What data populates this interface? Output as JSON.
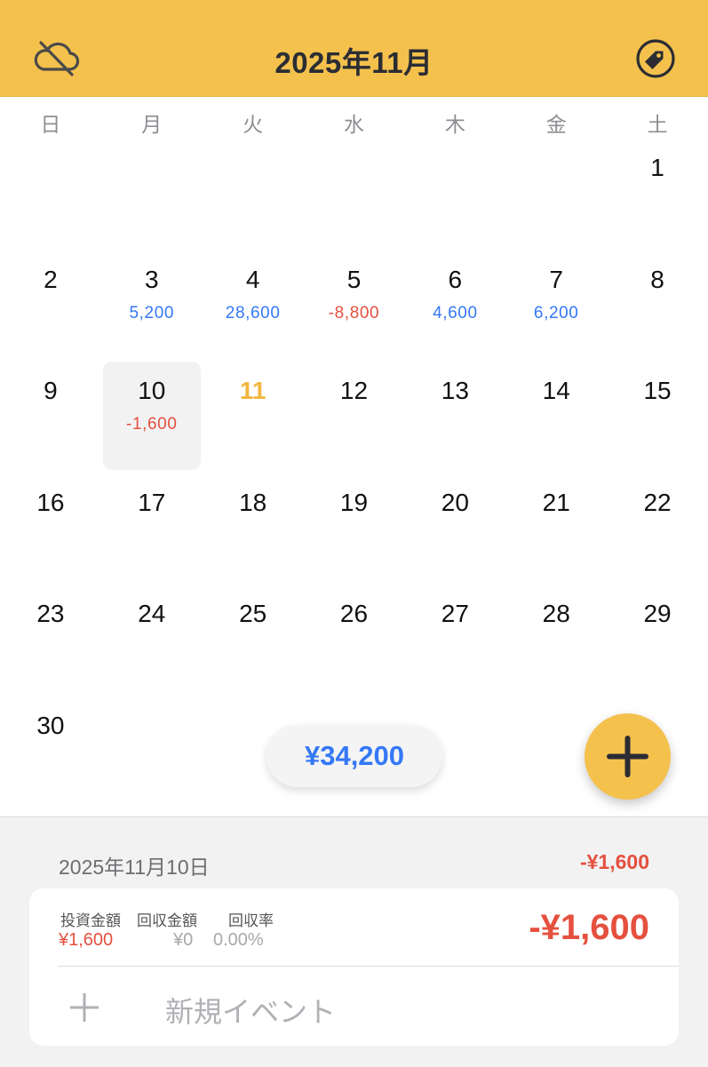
{
  "header": {
    "title": "2025年11月",
    "left_icon": "cloud-off-icon",
    "right_icon": "tag-icon",
    "color": "#f4c14d"
  },
  "weekdays": [
    "日",
    "月",
    "火",
    "水",
    "木",
    "金",
    "土"
  ],
  "month": {
    "first_weekday_index": 6,
    "days_in_month": 30,
    "today": 11,
    "selected": 10,
    "amounts": {
      "3": "5,200",
      "4": "28,600",
      "5": "-8,800",
      "6": "4,600",
      "7": "6,200",
      "10": "-1,600"
    }
  },
  "total_pill": "¥34,200",
  "fab_icon": "plus-icon",
  "detail": {
    "date": "2025年11月10日",
    "total": "-¥1,600",
    "invest_label": "投資金額",
    "invest_value": "¥1,600",
    "return_label": "回収金額",
    "return_value": "¥0",
    "rate_label": "回収率",
    "rate_value": "0.00%",
    "card_total": "-¥1,600",
    "new_event_label": "新規イベント"
  },
  "colors": {
    "accent": "#f4c14d",
    "positive": "#3478f6",
    "negative": "#e5503f"
  }
}
